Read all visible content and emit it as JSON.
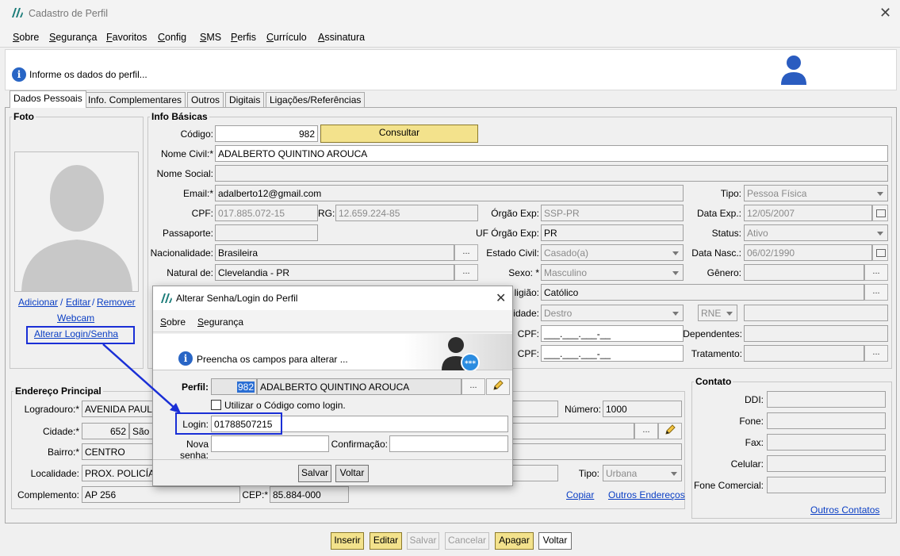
{
  "window": {
    "title": "Cadastro de Perfil"
  },
  "menu": [
    "Sobre",
    "Segurança",
    "Favoritos",
    "Config",
    "SMS",
    "Perfis",
    "Currículo",
    "Assinatura"
  ],
  "header": {
    "info_text": "Informe os dados do perfil..."
  },
  "tabs": [
    "Dados Pessoais",
    "Info. Complementares",
    "Outros",
    "Digitais",
    "Ligações/Referências"
  ],
  "foto": {
    "legend": "Foto",
    "links": {
      "adicionar": "Adicionar",
      "editar": "Editar",
      "remover": "Remover",
      "webcam": "Webcam",
      "alterar": "Alterar Login/Senha"
    },
    "sep": "/"
  },
  "info_basicas": {
    "legend": "Info Básicas",
    "codigo_label": "Código:",
    "codigo": "982",
    "consultar": "Consultar",
    "nome_civil_label": "Nome Civil:*",
    "nome_civil": "ADALBERTO QUINTINO AROUCA",
    "nome_social_label": "Nome Social:",
    "nome_social": "",
    "email_label": "Email:*",
    "email": "adalberto12@gmail.com",
    "tipo_label": "Tipo:",
    "tipo": "Pessoa Física",
    "cpf_label": "CPF:",
    "cpf": "017.885.072-15",
    "rg_label": "RG:",
    "rg": "12.659.224-85",
    "orgao_label": "Órgão Exp:",
    "orgao": "SSP-PR",
    "data_exp_label": "Data Exp.:",
    "data_exp": "12/05/2007",
    "passaporte_label": "Passaporte:",
    "passaporte": "",
    "uf_orgao_label": "UF Órgão Exp:",
    "uf_orgao": "PR",
    "status_label": "Status:",
    "status": "Ativo",
    "nacionalidade_label": "Nacionalidade:",
    "nacionalidade": "Brasileira",
    "estado_civil_label": "Estado Civil:",
    "estado_civil": "Casado(a)",
    "data_nasc_label": "Data Nasc.:",
    "data_nasc": "06/02/1990",
    "natural_label": "Natural de:",
    "natural": "Clevelandia - PR",
    "sexo_label": "Sexo: *",
    "sexo": "Masculino",
    "genero_label": "Gênero:",
    "genero": "",
    "religiao_label": "ligião:",
    "religiao": "Católico",
    "lateralidade_label": "idade:",
    "lateralidade": "Destro",
    "rne": "RNE",
    "cpf1_label": "CPF:",
    "cpf1": "___.___.___-__",
    "dependentes_label": "Dependentes:",
    "cpf2_label": "CPF:",
    "cpf2": "___.___.___-__",
    "tratamento_label": "Tratamento:"
  },
  "endereco": {
    "legend": "Endereço Principal",
    "logradouro_label": "Logradouro:*",
    "logradouro": "AVENIDA PAULI",
    "numero_label": "Número:",
    "numero": "1000",
    "cidade_label": "Cidade:*",
    "cidade_cod": "652",
    "cidade": "São P",
    "bairro_label": "Bairro:*",
    "bairro": "CENTRO",
    "localidade_label": "Localidade:",
    "localidade": "PROX. POLICÍA",
    "tipo_label": "Tipo:",
    "tipo": "Urbana",
    "complemento_label": "Complemento:",
    "complemento": "AP 256",
    "cep_label": "CEP:*",
    "cep": "85.884-000",
    "copiar": "Copiar",
    "outros": "Outros Endereços"
  },
  "contato": {
    "legend": "Contato",
    "ddi": "DDI:",
    "fone": "Fone:",
    "fax": "Fax:",
    "celular": "Celular:",
    "fone_comercial": "Fone Comercial:",
    "outros": "Outros Contatos"
  },
  "buttons": {
    "inserir": "Inserir",
    "editar": "Editar",
    "salvar": "Salvar",
    "cancelar": "Cancelar",
    "apagar": "Apagar",
    "voltar": "Voltar"
  },
  "dialog": {
    "title": "Alterar Senha/Login do Perfil",
    "menu": [
      "Sobre",
      "Segurança"
    ],
    "info_text": "Preencha os campos para alterar ...",
    "perfil_label": "Perfil:",
    "perfil_cod": "982",
    "perfil_nome": "ADALBERTO QUINTINO AROUCA",
    "checkbox_label": "Utilizar o Código como login.",
    "login_label": "Login:",
    "login": "01788507215",
    "nova_senha_label": "Nova senha:",
    "confirmacao_label": "Confirmação:",
    "salvar": "Salvar",
    "voltar": "Voltar"
  },
  "colors": {
    "highlight": "#1a2fd6",
    "accent_button": "#f3e28c",
    "link": "#0a3ec4"
  }
}
